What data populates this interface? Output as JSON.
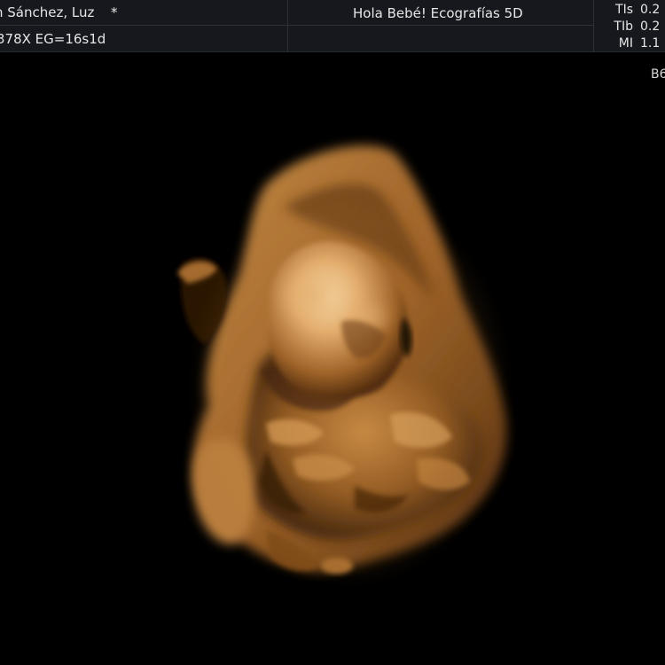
{
  "header": {
    "patient_name": "n Sánchez, Luz",
    "patient_flag": "*",
    "study_info": "378X  EG=16s1d",
    "clinic_name": "Hola Bebé! Ecografías 5D"
  },
  "indices": [
    {
      "label": "TIs",
      "value": "0.2"
    },
    {
      "label": "TIb",
      "value": "0.2"
    },
    {
      "label": "MI",
      "value": "1.1"
    }
  ],
  "mode_label": "B6",
  "colors": {
    "background": "#000000",
    "header_bg": "#16181d",
    "text": "#e6e6e6",
    "render_tint_light": "#f6cf98",
    "render_tint_mid": "#b67a37",
    "render_tint_dark": "#3d2108"
  },
  "image": {
    "type": "3D ultrasound render",
    "subject": "fetus"
  }
}
